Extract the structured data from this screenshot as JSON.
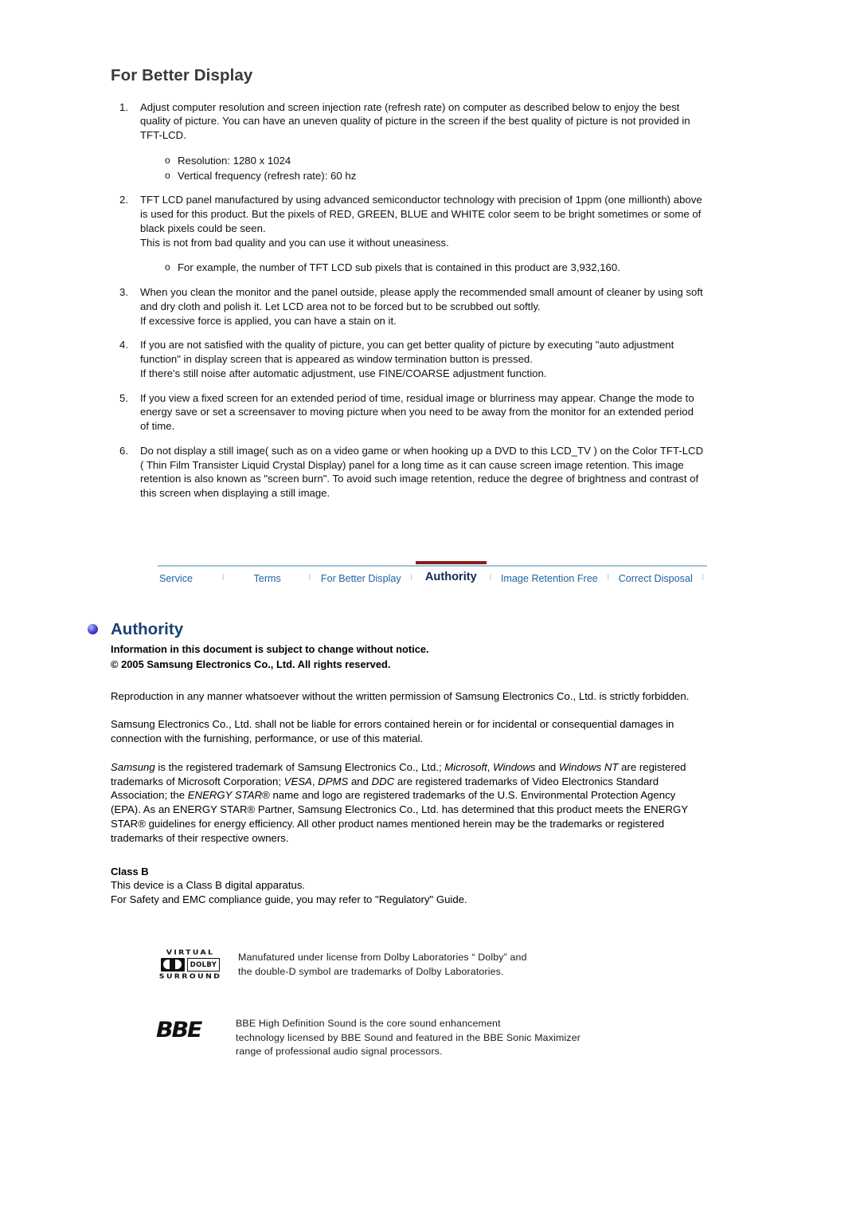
{
  "better_display": {
    "title": "For Better Display",
    "items": [
      {
        "num": "1.",
        "paragraphs": [
          "Adjust computer resolution and screen injection rate (refresh rate) on computer as described below to enjoy the best quality of picture. You can have an uneven quality of picture in the screen if the best quality of picture is not provided in TFT-LCD."
        ],
        "sub_bullets": [
          "Resolution: 1280 x 1024",
          "Vertical frequency (refresh rate): 60 hz"
        ]
      },
      {
        "num": "2.",
        "paragraphs": [
          "TFT LCD panel manufactured by using advanced semiconductor technology with precision of 1ppm (one millionth) above is used for this product. But the pixels of RED, GREEN, BLUE and WHITE color seem to be bright sometimes or some of black pixels could be seen.",
          "This is not from bad quality and you can use it without uneasiness."
        ],
        "sub_bullets": [
          "For example, the number of TFT LCD sub pixels that is contained in this product are 3,932,160."
        ]
      },
      {
        "num": "3.",
        "paragraphs": [
          "When you clean the monitor and the panel outside, please apply the recommended small amount of cleaner by using soft and dry cloth and polish it. Let LCD area not to be forced but to be scrubbed out softly.",
          "If excessive force is applied, you can have a stain on it."
        ],
        "sub_bullets": []
      },
      {
        "num": "4.",
        "paragraphs": [
          "If you are not satisfied with the quality of picture, you can get better quality of picture by executing \"auto adjustment function\" in display screen that is appeared as window termination button is pressed.",
          "If there's still noise after automatic adjustment, use FINE/COARSE adjustment function."
        ],
        "sub_bullets": []
      },
      {
        "num": "5.",
        "paragraphs": [
          "If you view a fixed screen for an extended period of time, residual image or blurriness may appear. Change the mode to energy save or set a screensaver to moving picture when you need to be away from the monitor for an extended period of time."
        ],
        "sub_bullets": []
      },
      {
        "num": "6.",
        "paragraphs": [
          "Do not display a still image( such as on a video game or when hooking up a DVD to this LCD_TV ) on the Color TFT-LCD ( Thin Film Transister Liquid Crystal Display) panel for a long time as it can cause screen image retention. This image retention is also known as \"screen burn\". To avoid such image retention, reduce the degree of brightness and contrast of this screen when displaying a still image."
        ],
        "sub_bullets": []
      }
    ],
    "bullet_glyph": "o"
  },
  "nav": {
    "separator": "l",
    "links": [
      {
        "label": "Service",
        "active": false
      },
      {
        "label": "Terms",
        "active": false
      },
      {
        "label": "For Better Display",
        "active": false
      },
      {
        "label": "Authority",
        "active": true
      },
      {
        "label": "Image Retention Free",
        "active": false
      },
      {
        "label": "Correct Disposal",
        "active": false
      }
    ],
    "active_underline_color": "#8b1c1c",
    "link_color": "#1f63a0",
    "rule_color": "#9fc3d9"
  },
  "authority": {
    "title": "Authority",
    "bullet_icon": "blue-orb-bullet",
    "notice_line_1": "Information in this document is subject to change without notice.",
    "notice_line_2": "© 2005 Samsung Electronics Co., Ltd. All rights reserved.",
    "paragraph_1": "Reproduction in any manner whatsoever without the written permission of Samsung Electronics Co., Ltd. is strictly forbidden.",
    "paragraph_2": "Samsung Electronics Co., Ltd. shall not be liable for errors contained herein or for incidental or consequential damages in connection with the furnishing, performance, or use of this material.",
    "trademark_paragraph": {
      "part_1_italic": "Samsung",
      "part_2": " is the registered trademark of Samsung Electronics Co., Ltd.; ",
      "part_3_italic": "Microsoft",
      "part_4": ", ",
      "part_5_italic": "Windows",
      "part_6": " and ",
      "part_7_italic": "Windows NT",
      "part_8": " are registered trademarks of Microsoft Corporation; ",
      "part_9_italic": "VESA",
      "part_10": ", ",
      "part_11_italic": "DPMS",
      "part_12": " and ",
      "part_13_italic": "DDC",
      "part_14": " are registered trademarks of Video Electronics Standard Association; the ",
      "part_15_italic": "ENERGY STAR",
      "part_16": "® name and logo are registered trademarks of the U.S. Environmental Protection Agency (EPA). As an ENERGY STAR® Partner, Samsung Electronics Co., Ltd. has determined that this product meets the ENERGY STAR® guidelines for energy efficiency. All other product names mentioned herein may be the trademarks or registered trademarks of their respective owners."
    },
    "class_b": {
      "title": "Class B",
      "line_1": "This device is a Class B digital apparatus.",
      "line_2": "For Safety and EMC compliance guide, you may refer to \"Regulatory\" Guide."
    }
  },
  "logos": {
    "dolby": {
      "top_word": "VIRTUAL",
      "brand_word": "DOLBY",
      "bottom_word": "SURROUND",
      "text_line_1": "Manufatured under license from Dolby Laboratories “ Dolby” and",
      "text_line_2": "the double-D symbol are trademarks of Dolby Laboratories."
    },
    "bbe": {
      "wordmark": "BBE",
      "text_line_1": "BBE High Definition Sound is the core sound enhancement",
      "text_line_2": "technology licensed by BBE Sound and featured in the BBE Sonic Maximizer",
      "text_line_3": "range of professional audio signal processors."
    }
  }
}
